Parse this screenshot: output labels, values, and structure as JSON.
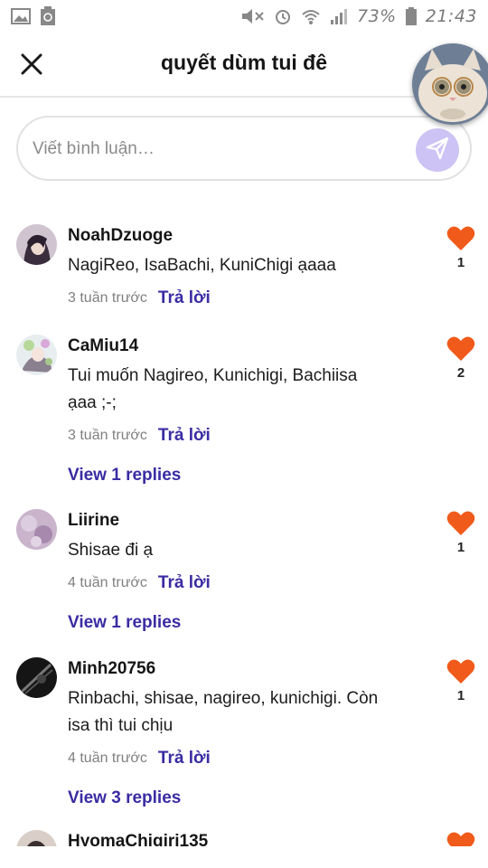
{
  "status_bar": {
    "battery": "73%",
    "time": "21:43",
    "left_icons": [
      "image-icon",
      "recycle-icon"
    ],
    "right_icons": [
      "mute-icon",
      "alarm-icon",
      "wifi-icon",
      "signal-icon",
      "battery-icon"
    ]
  },
  "header": {
    "title": "quyết dùm tui đê",
    "close_icon": "close-icon"
  },
  "comment_input": {
    "placeholder": "Viết bình luận…",
    "send_icon": "send-icon",
    "send_color": "#cdc3f4"
  },
  "colors": {
    "accent": "#3a2ca3",
    "heart": "#f05a1a"
  },
  "comments": [
    {
      "username": "NoahDzuoge",
      "text": "NagiReo, IsaBachi, KuniChigi ạaaa",
      "time": "3 tuần trước",
      "reply": "Trả lời",
      "likes": "1",
      "view_replies": ""
    },
    {
      "username": "CaMiu14",
      "text": "Tui muốn Nagireo, Kunichigi, Bachiisa ạaa ;-;",
      "time": "3 tuần trước",
      "reply": "Trả lời",
      "likes": "2",
      "view_replies": "View 1 replies"
    },
    {
      "username": "Liirine",
      "text": "Shisae đi ạ",
      "time": "4 tuần trước",
      "reply": "Trả lời",
      "likes": "1",
      "view_replies": "View 1 replies"
    },
    {
      "username": "Minh20756",
      "text": "Rinbachi, shisae, nagireo, kunichigi. Còn isa thì tui chịu",
      "time": "4 tuần trước",
      "reply": "Trả lời",
      "likes": "1",
      "view_replies": "View 3 replies"
    },
    {
      "username": "HyomaChigiri135",
      "text": "",
      "time": "",
      "reply": "",
      "likes": "",
      "view_replies": ""
    }
  ]
}
